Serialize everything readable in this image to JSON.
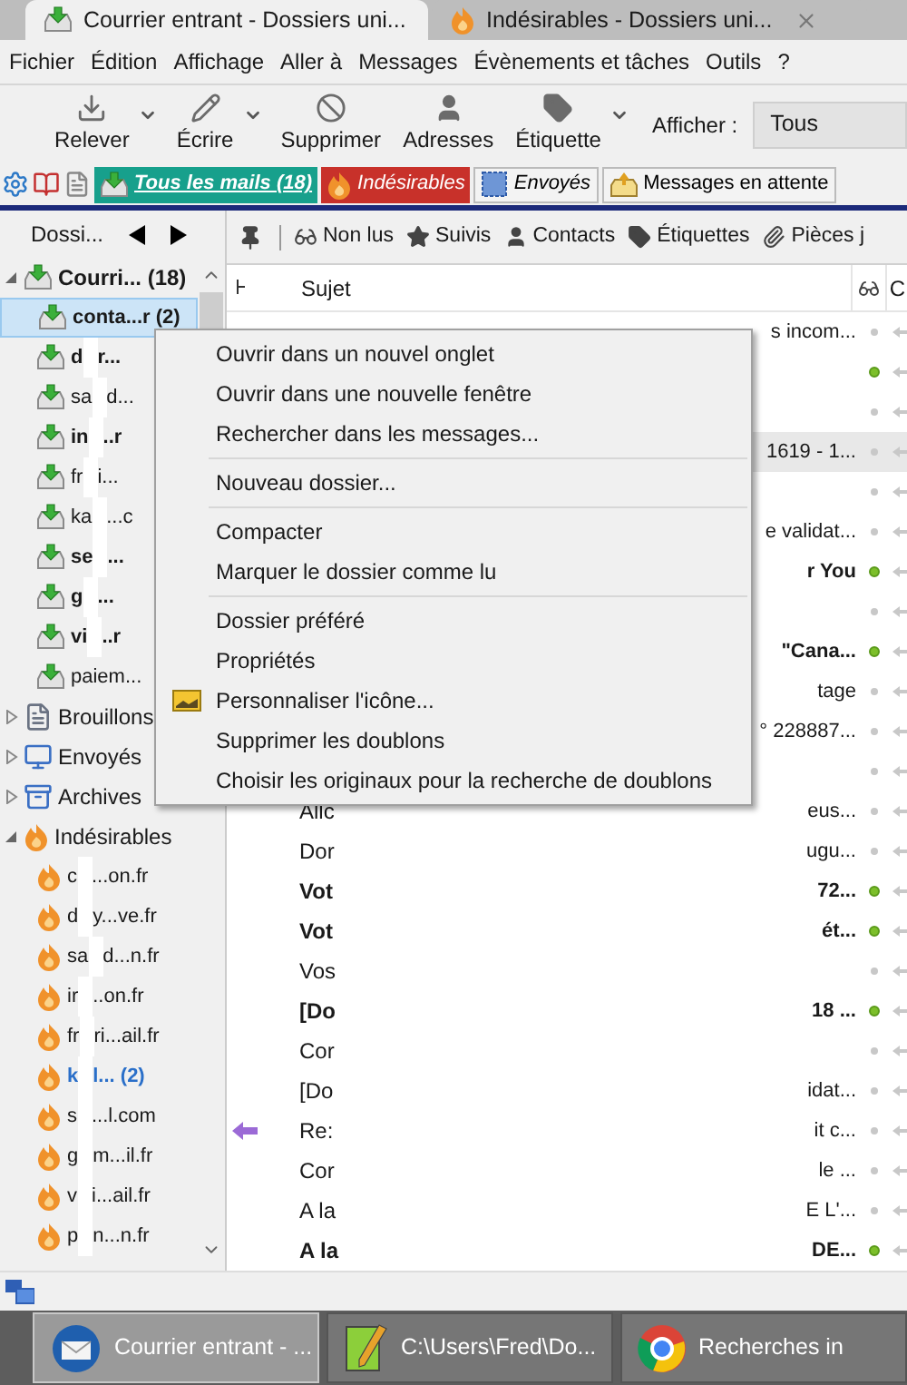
{
  "tabs": [
    {
      "label": "Courrier entrant - Dossiers uni...",
      "kind": "inbox",
      "selected": true,
      "closable": false
    },
    {
      "label": "Indésirables - Dossiers uni...",
      "kind": "junk",
      "selected": false,
      "closable": true
    }
  ],
  "menu_bar": [
    "Fichier",
    "Édition",
    "Affichage",
    "Aller à",
    "Messages",
    "Évènements et tâches",
    "Outils",
    "?"
  ],
  "toolbar": {
    "buttons": [
      {
        "label": "Relever",
        "kind": "get",
        "dropdown": true
      },
      {
        "label": "Écrire",
        "kind": "write",
        "dropdown": true
      },
      {
        "label": "Supprimer",
        "kind": "delete",
        "dropdown": false
      },
      {
        "label": "Adresses",
        "kind": "contacts",
        "dropdown": false
      },
      {
        "label": "Étiquette",
        "kind": "tag",
        "dropdown": true
      }
    ],
    "show_label": "Afficher :",
    "show_value": "Tous"
  },
  "favorites": [
    {
      "label": "Tous les mails (18)",
      "kind": "all"
    },
    {
      "label": "Indésirables",
      "kind": "junk"
    },
    {
      "label": "Envoyés",
      "kind": "sent"
    },
    {
      "label": "Messages en attente",
      "kind": "outbox"
    }
  ],
  "folder_pane": {
    "title": "Dossi...",
    "folders": [
      {
        "name": "Courri... (18)",
        "kind": "inbox",
        "expanded": true,
        "unread": true,
        "children": [
          {
            "name": "conta...r (2)",
            "kind": "inbox",
            "unread": true,
            "selected": true,
            "new_mail": false
          },
          {
            "name": "d",
            "name_end": "r...",
            "kind": "inbox",
            "unread": true,
            "selected": false,
            "new_mail": false
          },
          {
            "name": "sa",
            "name_end": "d...",
            "kind": "inbox",
            "unread": false,
            "selected": false,
            "new_mail": false
          },
          {
            "name": "in",
            "name_end": "..r",
            "kind": "inbox",
            "unread": true,
            "selected": false,
            "new_mail": false
          },
          {
            "name": "fr",
            "name_end": "i...",
            "kind": "inbox",
            "unread": false,
            "selected": false,
            "new_mail": false
          },
          {
            "name": "ka",
            "name_end": "...c",
            "kind": "inbox",
            "unread": false,
            "selected": false,
            "new_mail": false
          },
          {
            "name": "se",
            "name_end": "...",
            "kind": "inbox",
            "unread": true,
            "selected": false,
            "new_mail": false
          },
          {
            "name": "g",
            "name_end": "...",
            "kind": "inbox",
            "unread": true,
            "selected": false,
            "new_mail": false
          },
          {
            "name": "vi",
            "name_end": "..r",
            "kind": "inbox",
            "unread": true,
            "selected": false,
            "new_mail": false
          },
          {
            "name": "paiem...",
            "kind": "inbox",
            "unread": false,
            "selected": false,
            "new_mail": false
          }
        ]
      },
      {
        "name": "Brouillons",
        "kind": "drafts",
        "expanded": false,
        "unread": false
      },
      {
        "name": "Envoyés",
        "kind": "sent",
        "expanded": false,
        "unread": false
      },
      {
        "name": "Archives",
        "kind": "archive",
        "expanded": false,
        "unread": false
      },
      {
        "name": "Indésirables",
        "kind": "junk",
        "expanded": true,
        "unread": false,
        "children": [
          {
            "name": "c",
            "name_end": "...on.fr",
            "kind": "junk",
            "unread": false,
            "selected": false,
            "new_mail": false
          },
          {
            "name": "d",
            "name_end": "y...ve.fr",
            "kind": "junk",
            "unread": false,
            "selected": false,
            "new_mail": false
          },
          {
            "name": "sa",
            "name_end": "d...n.fr",
            "kind": "junk",
            "unread": false,
            "selected": false,
            "new_mail": false
          },
          {
            "name": "ir",
            "name_end": "..on.fr",
            "kind": "junk",
            "unread": false,
            "selected": false,
            "new_mail": false
          },
          {
            "name": "fr",
            "name_end": "ri...ail.fr",
            "kind": "junk",
            "unread": false,
            "selected": false,
            "new_mail": false
          },
          {
            "name": "k",
            "name_end": "l... (2)",
            "kind": "junk",
            "unread": true,
            "selected": false,
            "new_mail": true
          },
          {
            "name": "s",
            "name_end": "...l.com",
            "kind": "junk",
            "unread": false,
            "selected": false,
            "new_mail": false
          },
          {
            "name": "g",
            "name_end": "m...il.fr",
            "kind": "junk",
            "unread": false,
            "selected": false,
            "new_mail": false
          },
          {
            "name": "v",
            "name_end": "i...ail.fr",
            "kind": "junk",
            "unread": false,
            "selected": false,
            "new_mail": false
          },
          {
            "name": "p",
            "name_end": "n...n.fr",
            "kind": "junk",
            "unread": false,
            "selected": false,
            "new_mail": false
          }
        ]
      }
    ]
  },
  "quick_filter": [
    {
      "label": "Non lus",
      "kind": "unread"
    },
    {
      "label": "Suivis",
      "kind": "starred"
    },
    {
      "label": "Contacts",
      "kind": "contacts"
    },
    {
      "label": "Étiquettes",
      "kind": "tags"
    },
    {
      "label": "Pièces j",
      "kind": "attachments"
    }
  ],
  "columns": [
    "Sujet",
    "C"
  ],
  "messages": [
    {
      "subject_end": "s incom...",
      "unread": false,
      "selected": false,
      "replied": false
    },
    {
      "unread": true,
      "selected": false,
      "replied": false
    },
    {
      "unread": false,
      "selected": false,
      "replied": false
    },
    {
      "subject_end": "1619 - 1...",
      "unread": false,
      "selected": true,
      "replied": false
    },
    {
      "unread": false,
      "selected": false,
      "replied": false
    },
    {
      "subject_end": "e validat...",
      "unread": false,
      "selected": false,
      "replied": false
    },
    {
      "subject_end": "r You",
      "unread": true,
      "selected": false,
      "replied": false
    },
    {
      "unread": false,
      "selected": false,
      "replied": false
    },
    {
      "subject_end": "\"Cana...",
      "unread": true,
      "selected": false,
      "replied": false
    },
    {
      "subject_end": "tage",
      "unread": false,
      "selected": false,
      "replied": false
    },
    {
      "subject_end": "° 228887...",
      "unread": false,
      "selected": false,
      "replied": false
    },
    {
      "unread": false,
      "selected": false,
      "replied": false
    },
    {
      "subject": "Allc",
      "subject_end": "eus...",
      "unread": false,
      "selected": false,
      "replied": false
    },
    {
      "subject": "Dor",
      "subject_end": "ugu...",
      "unread": false,
      "selected": false,
      "replied": false
    },
    {
      "subject": "Vot",
      "subject_end": "72...",
      "unread": true,
      "selected": false,
      "replied": false
    },
    {
      "subject": "Vot",
      "subject_end": "ét...",
      "unread": true,
      "selected": false,
      "replied": false
    },
    {
      "subject": "Vos",
      "unread": false,
      "selected": false,
      "replied": false
    },
    {
      "subject": "[Do",
      "subject_end": "18 ...",
      "unread": true,
      "selected": false,
      "replied": false
    },
    {
      "subject": "Cor",
      "unread": false,
      "selected": false,
      "replied": false
    },
    {
      "subject": "[Do",
      "subject_end": "idat...",
      "unread": false,
      "selected": false,
      "replied": false
    },
    {
      "subject": "Re:",
      "subject_end": "it c...",
      "unread": false,
      "selected": false,
      "replied": true
    },
    {
      "subject": "Cor",
      "subject_end": "le ...",
      "unread": false,
      "selected": false,
      "replied": false
    },
    {
      "subject": "A la",
      "subject_end": "E L'...",
      "unread": false,
      "selected": false,
      "replied": false
    },
    {
      "subject": "A la",
      "subject_end": "DE...",
      "unread": true,
      "selected": false,
      "replied": false
    }
  ],
  "context_menu": [
    {
      "kind": "item",
      "label": "Ouvrir dans un nouvel onglet"
    },
    {
      "kind": "item",
      "label": "Ouvrir dans une nouvelle fenêtre"
    },
    {
      "kind": "item",
      "label": "Rechercher dans les messages..."
    },
    {
      "kind": "separator"
    },
    {
      "kind": "item",
      "label": "Nouveau dossier..."
    },
    {
      "kind": "separator"
    },
    {
      "kind": "item",
      "label": "Compacter"
    },
    {
      "kind": "item",
      "label": "Marquer le dossier comme lu"
    },
    {
      "kind": "separator"
    },
    {
      "kind": "item",
      "label": "Dossier préféré"
    },
    {
      "kind": "item",
      "label": "Propriétés"
    },
    {
      "kind": "item",
      "label": "Personnaliser l'icône...",
      "icon": true
    },
    {
      "kind": "item",
      "label": "Supprimer les doublons"
    },
    {
      "kind": "item",
      "label": "Choisir les originaux pour la recherche de doublons"
    }
  ],
  "taskbar": [
    {
      "label": "Courrier entrant - ...",
      "kind": "mail",
      "selected": true
    },
    {
      "label": "C:\\Users\\Fred\\Do...",
      "kind": "editor",
      "selected": false
    },
    {
      "label": "Recherches in",
      "kind": "browser",
      "selected": false
    }
  ]
}
